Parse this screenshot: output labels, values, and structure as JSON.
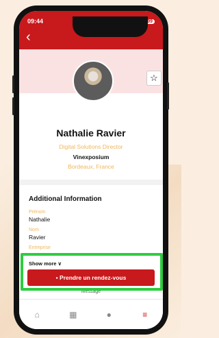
{
  "status": {
    "time": "09:44",
    "battery": "99"
  },
  "profile": {
    "name": "Nathalie Ravier",
    "job_title": "Digital Solutions Director",
    "company": "Vinexposium",
    "location": "Bordeaux, France"
  },
  "additional": {
    "title": "Additional Information",
    "fields": [
      {
        "label": "Prénom",
        "value": "Nathalie"
      },
      {
        "label": "Nom",
        "value": "Ravier"
      },
      {
        "label": "Entreprise",
        "value": ""
      }
    ],
    "show_more": "Show more ∨"
  },
  "actions": {
    "appointment_label": "Prendre un rendez-vous",
    "message_label": "Message"
  },
  "colors": {
    "brand": "#c8191c",
    "accent": "#f0b65a",
    "highlight": "#2ecc40"
  },
  "icons": [
    "home-icon",
    "calendar-icon",
    "chat-icon",
    "menu-icon",
    "star-icon",
    "back-arrow-icon"
  ]
}
